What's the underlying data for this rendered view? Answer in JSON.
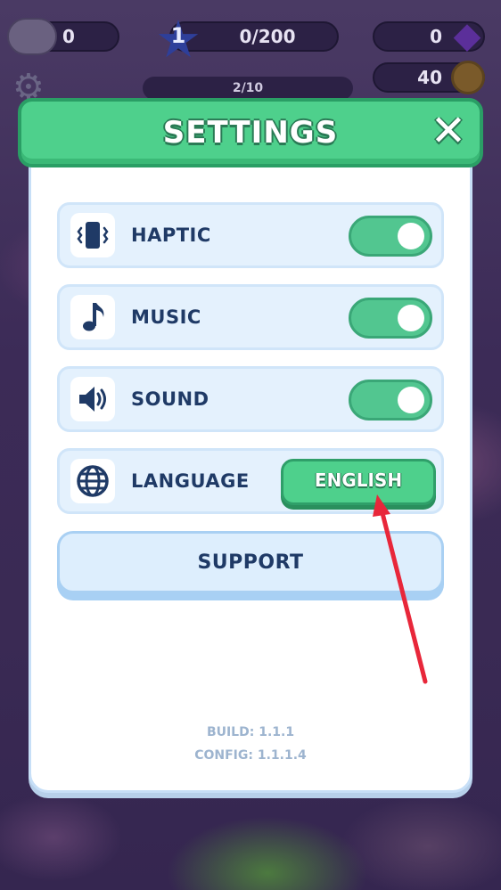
{
  "hud": {
    "friends_count": "0",
    "level": "1",
    "xp_progress": "0/200",
    "quest_progress": "2/10",
    "gems": "0",
    "coins": "40"
  },
  "settings": {
    "title": "SETTINGS",
    "close_label": "✕",
    "rows": [
      {
        "label": "HAPTIC",
        "icon": "phone-vibrate-icon",
        "enabled": true
      },
      {
        "label": "MUSIC",
        "icon": "music-note-icon",
        "enabled": true
      },
      {
        "label": "SOUND",
        "icon": "speaker-icon",
        "enabled": true
      }
    ],
    "language": {
      "label": "LANGUAGE",
      "icon": "globe-icon",
      "value": "ENGLISH"
    },
    "support_label": "SUPPORT",
    "build": "BUILD: 1.1.1",
    "config": "CONFIG: 1.1.1.4"
  },
  "colors": {
    "header_green": "#4ed08c",
    "toggle_green": "#52c690",
    "text_navy": "#1f3a66",
    "row_bg": "#e4f1fd",
    "arrow_red": "#e8273a"
  }
}
